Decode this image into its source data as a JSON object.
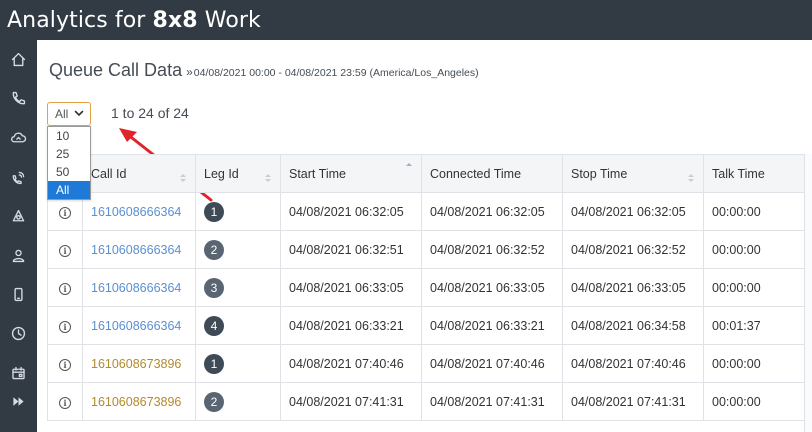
{
  "header": {
    "brand_prefix": "Analytics for ",
    "brand_8x8": "8x8",
    "brand_suffix": " Work"
  },
  "sidebar": {
    "items": [
      {
        "name": "home-icon"
      },
      {
        "name": "phone-icon"
      },
      {
        "name": "cloud-icon"
      },
      {
        "name": "group-calls-icon"
      },
      {
        "name": "queues-icon"
      },
      {
        "name": "user-icon"
      },
      {
        "name": "mobile-icon"
      },
      {
        "name": "clock-icon"
      },
      {
        "name": "calendar-icon"
      },
      {
        "name": "fast-forward-icon"
      }
    ]
  },
  "page": {
    "title": "Queue Call Data",
    "range_glyph": "»",
    "date_range": "04/08/2021 00:00 - 04/08/2021 23:59 (America/Los_Angeles)"
  },
  "pagination": {
    "selected": "All",
    "options": [
      "10",
      "25",
      "50",
      "All"
    ],
    "info": "1 to 24 of 24"
  },
  "colors": {
    "link_blue": "#5b8fd1",
    "link_gold": "#b38a2a",
    "annotation_arrow": "#e0242a",
    "selected_option": "#1e7ad6",
    "select_border": "#e3a24a"
  },
  "table": {
    "columns": [
      "",
      "Call Id",
      "Leg Id",
      "Start Time",
      "Connected Time",
      "Stop Time",
      "Talk Time"
    ],
    "rows": [
      {
        "call_id": "1610608666364",
        "color": "#5b8fd1",
        "leg": "1",
        "start": "04/08/2021 06:32:05",
        "connected": "04/08/2021 06:32:05",
        "stop": "04/08/2021 06:32:05",
        "talk": "00:00:00"
      },
      {
        "call_id": "1610608666364",
        "color": "#5b8fd1",
        "leg": "2",
        "start": "04/08/2021 06:32:51",
        "connected": "04/08/2021 06:32:52",
        "stop": "04/08/2021 06:32:52",
        "talk": "00:00:00"
      },
      {
        "call_id": "1610608666364",
        "color": "#5b8fd1",
        "leg": "3",
        "start": "04/08/2021 06:33:05",
        "connected": "04/08/2021 06:33:05",
        "stop": "04/08/2021 06:33:05",
        "talk": "00:00:00"
      },
      {
        "call_id": "1610608666364",
        "color": "#5b8fd1",
        "leg": "4",
        "start": "04/08/2021 06:33:21",
        "connected": "04/08/2021 06:33:21",
        "stop": "04/08/2021 06:34:58",
        "talk": "00:01:37"
      },
      {
        "call_id": "1610608673896",
        "color": "#b38a2a",
        "leg": "1",
        "start": "04/08/2021 07:40:46",
        "connected": "04/08/2021 07:40:46",
        "stop": "04/08/2021 07:40:46",
        "talk": "00:00:00"
      },
      {
        "call_id": "1610608673896",
        "color": "#b38a2a",
        "leg": "2",
        "start": "04/08/2021 07:41:31",
        "connected": "04/08/2021 07:41:31",
        "stop": "04/08/2021 07:41:31",
        "talk": "00:00:00"
      }
    ]
  }
}
